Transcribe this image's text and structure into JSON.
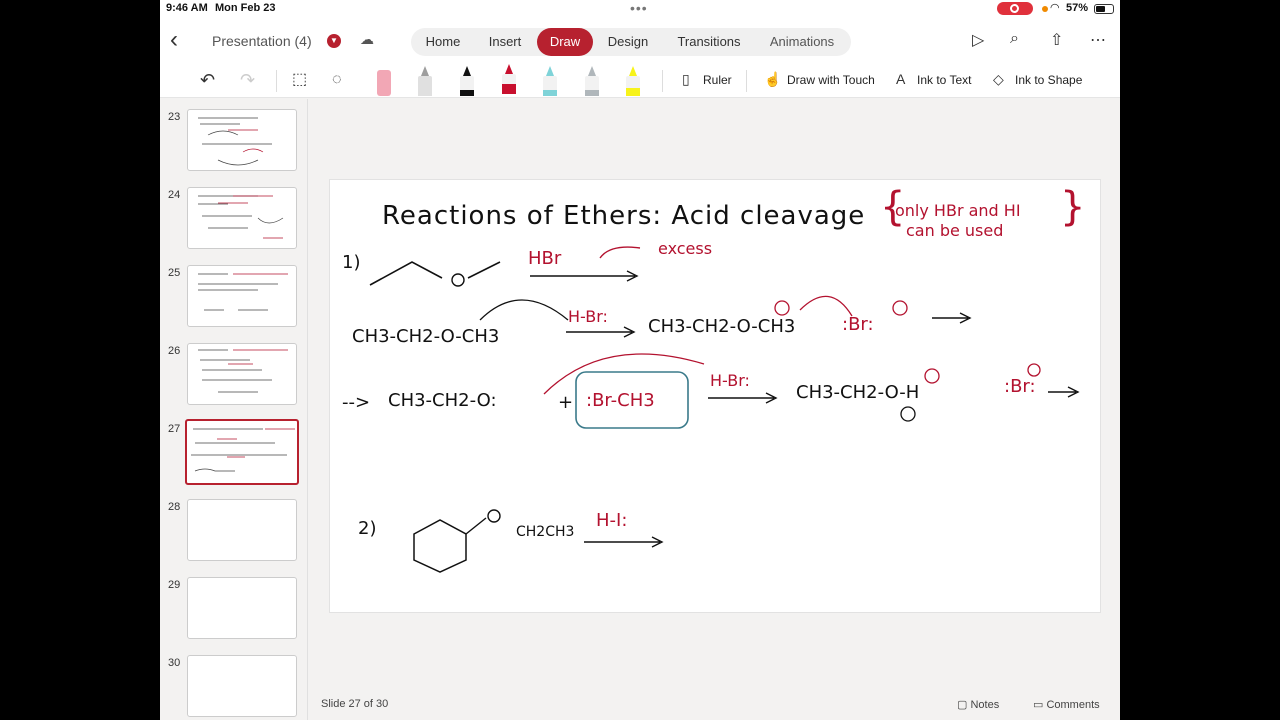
{
  "status": {
    "time": "9:46 AM",
    "date": "Mon Feb 23",
    "battery": "57%",
    "battery_level": 0.57
  },
  "title": {
    "doc_name": "Presentation (4)"
  },
  "tabs": [
    {
      "label": "Home"
    },
    {
      "label": "Insert"
    },
    {
      "label": "Draw"
    },
    {
      "label": "Design"
    },
    {
      "label": "Transitions"
    },
    {
      "label": "Animations"
    }
  ],
  "active_tab": "Draw",
  "toolbar": {
    "ruler": "Ruler",
    "draw_touch": "Draw with Touch",
    "ink_text": "Ink to Text",
    "ink_shape": "Ink to Shape"
  },
  "pens": [
    {
      "name": "eraser",
      "color": "#f2a7b5"
    },
    {
      "name": "pencil",
      "color": "#9e9e9e"
    },
    {
      "name": "black-pen",
      "color": "#111111"
    },
    {
      "name": "red-pen",
      "color": "#c8102e"
    },
    {
      "name": "teal-pen",
      "color": "#7fd3d8"
    },
    {
      "name": "gray-pen",
      "color": "#b0b7bb"
    },
    {
      "name": "highlighter",
      "color": "#f7f31a"
    }
  ],
  "thumbnails": [
    {
      "num": "23"
    },
    {
      "num": "24"
    },
    {
      "num": "25"
    },
    {
      "num": "26"
    },
    {
      "num": "27"
    },
    {
      "num": "28"
    },
    {
      "num": "29"
    },
    {
      "num": "30"
    }
  ],
  "selected_slide": "27",
  "slide": {
    "title": "Reactions of Ethers: Acid cleavage",
    "note_line1": "only HBr and HI",
    "note_line2": "can be used",
    "step1": "1)",
    "reagent1": "HBr",
    "excess": "excess",
    "r2_left": "CH3-CH2-O-CH3",
    "r2_reagent": "H-Br:",
    "r2_product": "CH3-CH2-O-CH3",
    "r2_br": ":Br:",
    "r3_arrow": "-->",
    "r3_left": "CH3-CH2-O:",
    "r3_plus": "+",
    "r3_box": ":Br-CH3",
    "r3_reagent": "H-Br:",
    "r3_right": "CH3-CH2-O-H",
    "r3_br": ":Br:",
    "step2": "2)",
    "s2_chain": "CH2CH3",
    "s2_reagent": "H-I:"
  },
  "colors": {
    "accent": "#b7212f",
    "ink_red": "#b3122f",
    "ink_black": "#111111"
  },
  "footer": {
    "slide_count": "Slide 27 of 30",
    "notes": "Notes",
    "comments": "Comments"
  }
}
